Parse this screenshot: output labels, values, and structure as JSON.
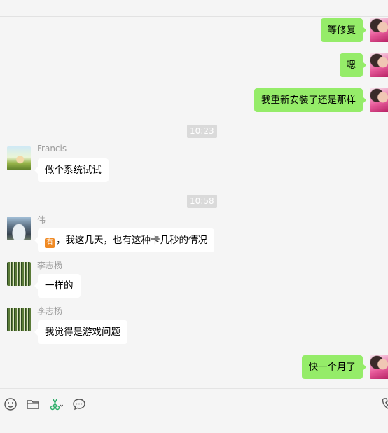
{
  "header": {
    "title_fragment": "    "
  },
  "messages": [
    {
      "side": "out",
      "text": "等修复"
    },
    {
      "side": "out",
      "text": "嗯"
    },
    {
      "side": "out",
      "text": "我重新安装了还是那样"
    },
    {
      "side": "time",
      "text": "10:23"
    },
    {
      "side": "in",
      "sender": "Francis",
      "text": "做个系统试试"
    },
    {
      "side": "time",
      "text": "10:58"
    },
    {
      "side": "in",
      "sender": "伟",
      "text": "，我这几天，也有这种卡几秒的情况"
    },
    {
      "side": "in",
      "sender": "李志杨",
      "text": "一样的"
    },
    {
      "side": "in",
      "sender": "李志杨",
      "text": "我觉得是游戏问题"
    },
    {
      "side": "out",
      "text": "快一个月了"
    }
  ],
  "toolbar": {
    "icons": [
      "emoji-icon",
      "folder-icon",
      "scissors-icon",
      "chat-history-icon",
      "phone-icon"
    ]
  }
}
